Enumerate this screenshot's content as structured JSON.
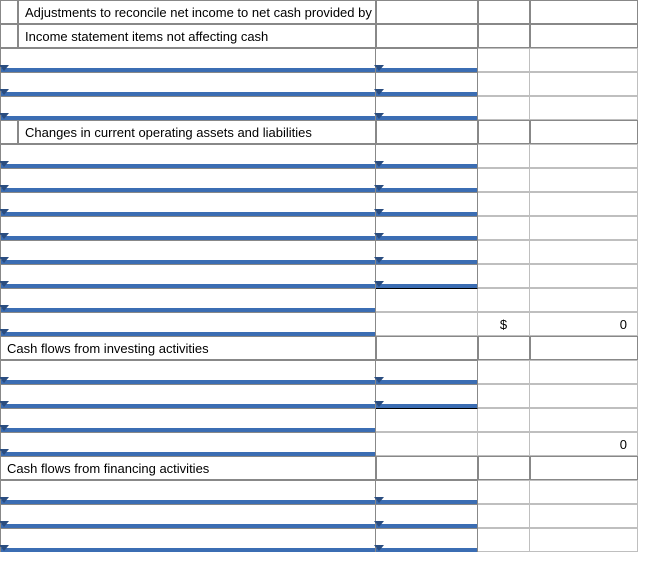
{
  "headers": {
    "adjustments": "Adjustments to reconcile net income to net cash provided by operating activities",
    "income_items": "Income statement items not affecting cash",
    "changes": "Changes in current operating assets and liabilities",
    "investing": "Cash flows from investing activities",
    "financing": "Cash flows from financing activities"
  },
  "totals": {
    "operating_symbol": "$",
    "operating_value": "0",
    "investing_value": "0"
  },
  "blank": ""
}
